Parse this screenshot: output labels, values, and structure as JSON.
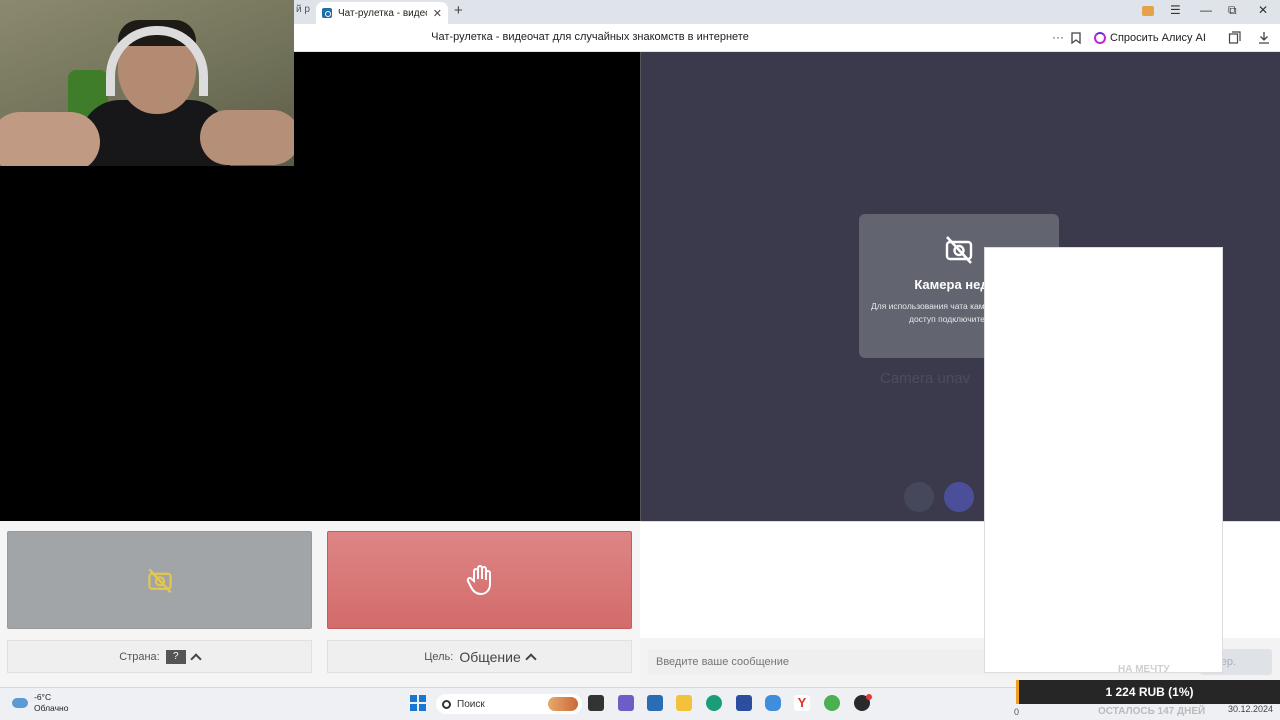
{
  "browser": {
    "prev_tab_partial": "й р",
    "active_tab_title": "Чат-рулетка - видеоча",
    "tab_close": "✕",
    "new_tab": "+",
    "page_title": "Чат-рулетка - видеочат для случайных знакомств в интернете",
    "address_more": "···",
    "alisa_label": "Спросить Алису AI",
    "window_controls": [
      "☰",
      "—",
      "⧉",
      "✕"
    ]
  },
  "camera_card": {
    "title": "Камера недос",
    "text": "Для использования чата камера. Разрешите доступ подключите устро",
    "faint_label": "Camera unav",
    "icon": "camera-off-icon"
  },
  "controls": {
    "stop_icon": "camera-off-icon",
    "start_icon": "hand-icon",
    "country_label": "Страна:",
    "country_value": "?",
    "goal_label": "Цель:",
    "goal_value": "Общение"
  },
  "chat": {
    "input_placeholder": "Введите ваше сообщение",
    "send_partial": "ер."
  },
  "donation": {
    "goal_label": "НА МЕЧТУ",
    "amount": "1 224 RUB (1%)",
    "days_left": "ОСТАЛОСЬ 147 ДНЕЙ"
  },
  "taskbar": {
    "weather_temp": "-6°C",
    "weather_desc": "Облачно",
    "search_label": "Поиск",
    "tray_left": "0",
    "tray_date": "30.12.2024"
  },
  "colors": {
    "right_video_bg": "#3a3a4c",
    "start_btn": "#d36b6b",
    "stop_btn": "#a2a5a7",
    "accent_yellow": "#e5c84a"
  }
}
